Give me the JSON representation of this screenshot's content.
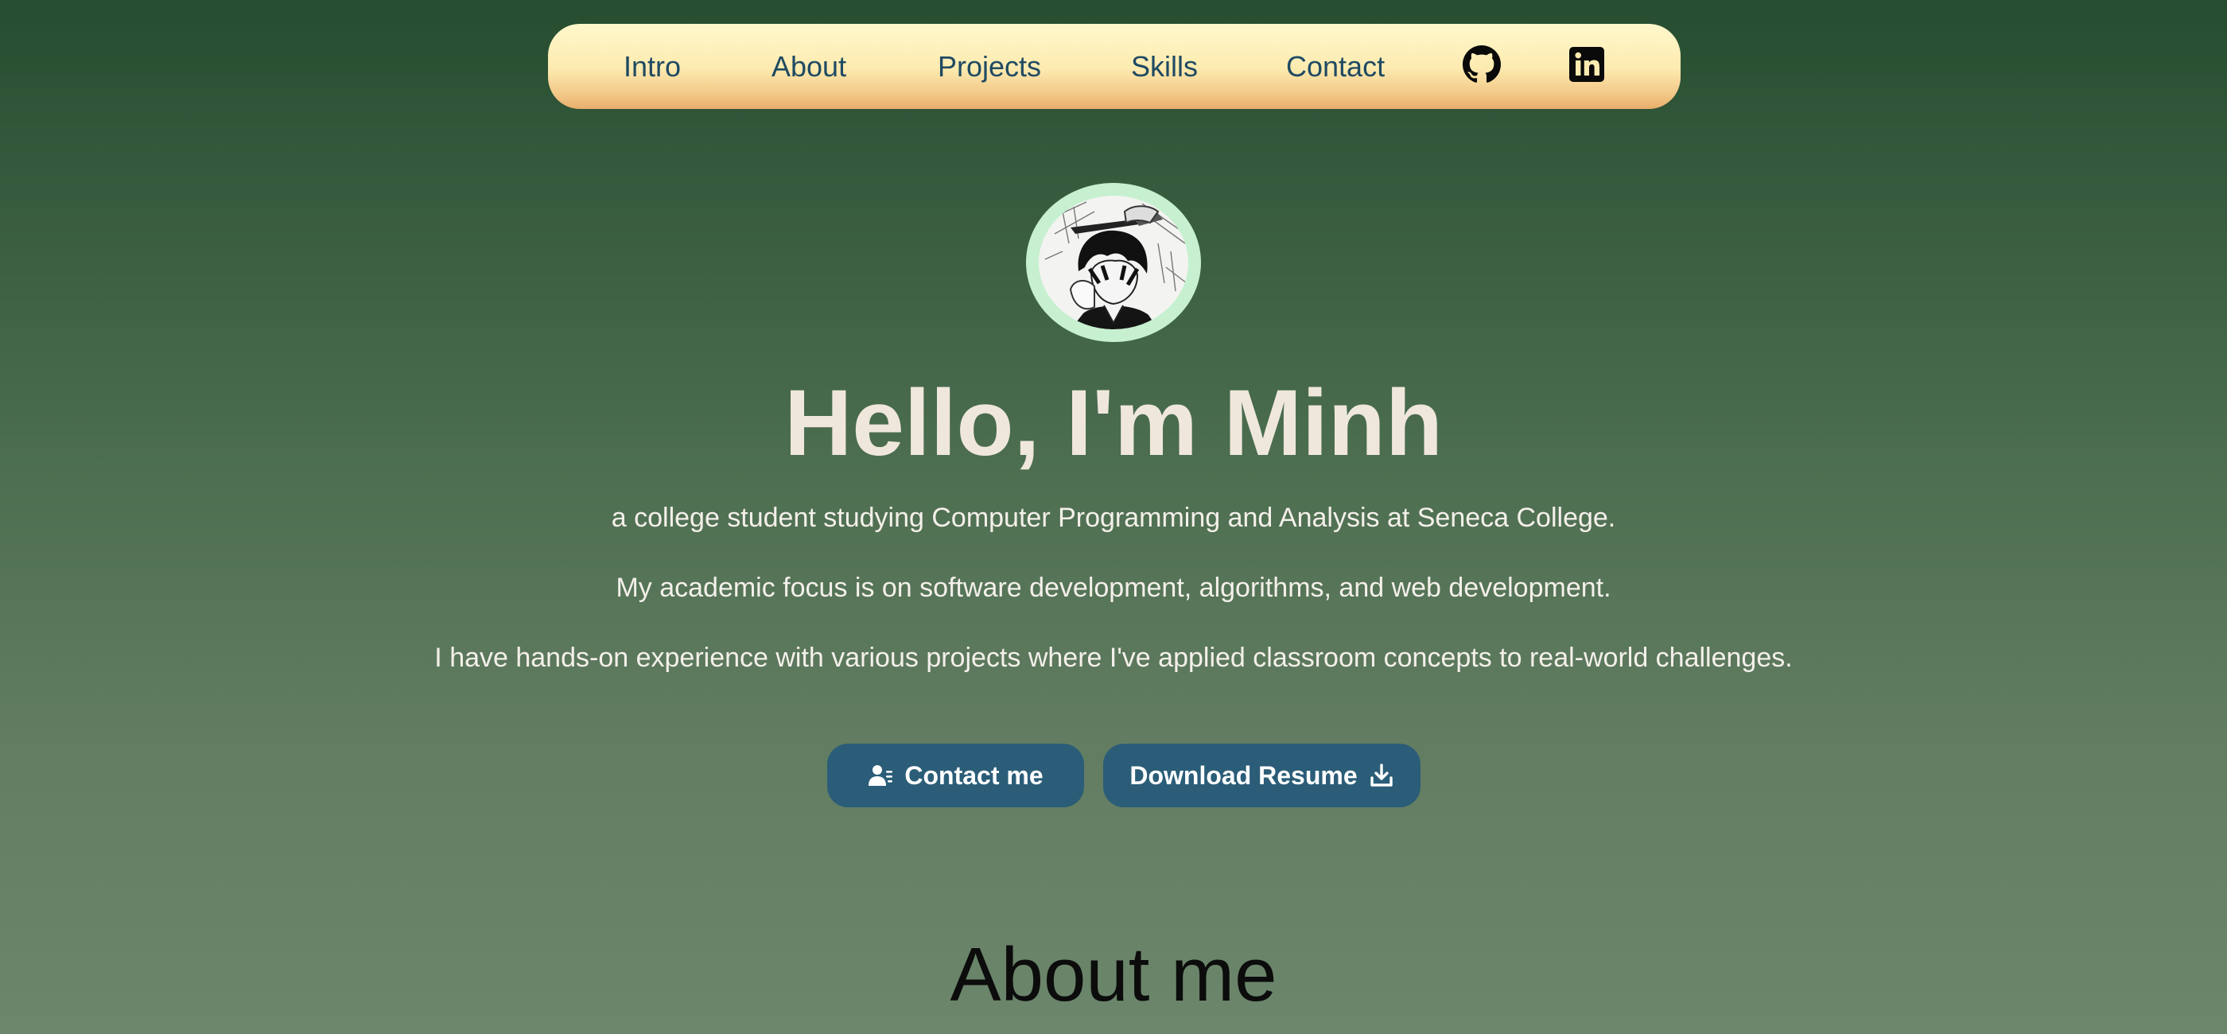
{
  "nav": {
    "links": [
      "Intro",
      "About",
      "Projects",
      "Skills",
      "Contact"
    ],
    "icons": [
      "github-icon",
      "linkedin-icon"
    ]
  },
  "hero": {
    "avatar": "avatar",
    "title": "Hello, I'm Minh",
    "lines": [
      "a college student studying Computer Programming and Analysis at Seneca College.",
      "My academic focus is on software development, algorithms, and web development.",
      "I have hands-on experience with various projects where I've applied classroom concepts to real-world challenges."
    ],
    "buttons": {
      "contact": {
        "label": "Contact me",
        "icon": "user-list-icon"
      },
      "resume": {
        "label": "Download Resume",
        "icon": "download-icon"
      }
    }
  },
  "about": {
    "title": "About me"
  },
  "colors": {
    "background_top": "#264d30",
    "background_bottom": "#6c866c",
    "nav_top": "#fff8cc",
    "nav_bottom": "#e8ad6c",
    "nav_text": "#1f4a62",
    "avatar_ring": "#c6f0cf",
    "button": "#2b5d78",
    "title_text": "#efe7dc"
  }
}
